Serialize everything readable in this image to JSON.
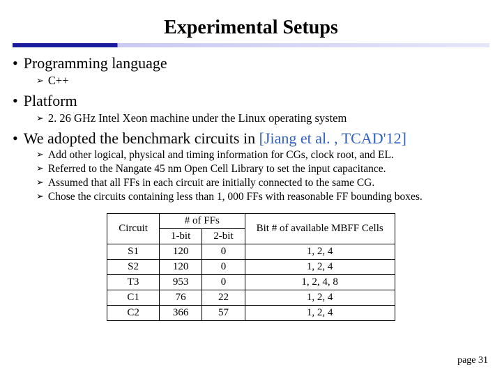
{
  "title": "Experimental Setups",
  "bullets": {
    "b1": {
      "label": "Programming language",
      "sub": [
        "C++"
      ]
    },
    "b2": {
      "label": "Platform",
      "sub": [
        "2. 26 GHz Intel Xeon machine under the Linux operating system"
      ]
    },
    "b3": {
      "label_pre": "We adopted the benchmark circuits in ",
      "label_ref": "[Jiang et al. , TCAD'12]",
      "sub": [
        "Add other logical, physical and timing information for CGs, clock root, and EL.",
        "Referred to the Nangate 45 nm Open Cell Library to set the input capacitance.",
        "Assumed that all FFs in each circuit are initially connected to the same CG.",
        "Chose the circuits containing less than 1, 000 FFs with reasonable FF bounding boxes."
      ]
    }
  },
  "table": {
    "head": {
      "c0": "Circuit",
      "c1": "# of FFs",
      "c1a": "1-bit",
      "c1b": "2-bit",
      "c2": "Bit # of available MBFF Cells"
    },
    "rows": [
      {
        "c0": "S1",
        "a": "120",
        "b": "0",
        "c": "1, 2, 4"
      },
      {
        "c0": "S2",
        "a": "120",
        "b": "0",
        "c": "1, 2, 4"
      },
      {
        "c0": "T3",
        "a": "953",
        "b": "0",
        "c": "1, 2, 4, 8"
      },
      {
        "c0": "C1",
        "a": "76",
        "b": "22",
        "c": "1, 2, 4"
      },
      {
        "c0": "C2",
        "a": "366",
        "b": "57",
        "c": "1, 2, 4"
      }
    ]
  },
  "page": "page 31"
}
